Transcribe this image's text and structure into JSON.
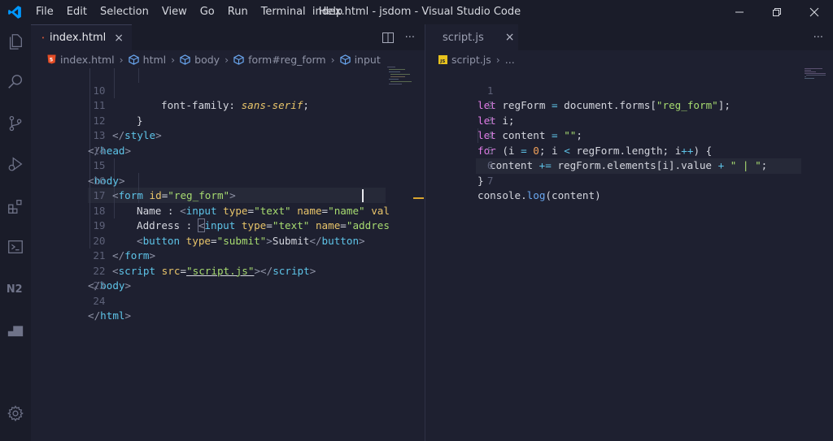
{
  "menu": [
    "File",
    "Edit",
    "Selection",
    "View",
    "Go",
    "Run",
    "Terminal",
    "Help"
  ],
  "window_title": "index.html - jsdom - Visual Studio Code",
  "colors": {
    "accent": "#0098ff",
    "html_icon": "#e44d26",
    "js_icon": "#e8c31d",
    "background": "#1e2030",
    "chrome": "#1a1c29"
  },
  "activity_icons": [
    "explorer-icon",
    "search-icon",
    "source-control-icon",
    "run-debug-icon",
    "extensions-icon",
    "terminal-icon",
    "n2-icon",
    "square-icon",
    "settings-gear-icon"
  ],
  "left": {
    "tab": {
      "label": "index.html",
      "close": "×",
      "icon": "html-file-icon"
    },
    "actions": {
      "split": "split-editor-icon",
      "more": "···"
    },
    "breadcrumb": [
      "index.html",
      "html",
      "body",
      "form#reg_form",
      "input"
    ],
    "line_numbers": [
      "10",
      "11",
      "12",
      "13",
      "14",
      "15",
      "16",
      "17",
      "18",
      "19",
      "20",
      "21",
      "22",
      "23",
      "24"
    ],
    "code": {
      "l10": {
        "prop": "font-family",
        "colon": ": ",
        "val": "sans-serif",
        "semi": ";"
      },
      "l11": "}",
      "l12": {
        "open": "</",
        "tag": "style",
        "close": ">"
      },
      "l13": {
        "open": "</",
        "tag": "head",
        "close": ">"
      },
      "l14": "",
      "l15": {
        "open": "<",
        "tag": "body",
        "close": ">"
      },
      "l16": {
        "open": "<",
        "tag": "form",
        "attr": " id",
        "eq": "=",
        "str": "\"reg_form\"",
        "close": ">"
      },
      "l17": {
        "text": "Name : ",
        "open": "<",
        "tag": "input",
        "a1": " type",
        "eq1": "=",
        "s1": "\"text\"",
        "a2": " name",
        "eq2": "=",
        "s2": "\"name\"",
        "a3": " val"
      },
      "l18": {
        "text": "Address : ",
        "open": "<",
        "tag": "input",
        "a1": " type",
        "eq1": "=",
        "s1": "\"text\"",
        "a2": " name",
        "eq2": "=",
        "s2": "\"addres"
      },
      "l19": {
        "open": "<",
        "tag": "button",
        "a1": " type",
        "eq1": "=",
        "s1": "\"submit\"",
        "close": ">",
        "text": "Submit",
        "copen": "</",
        "ctag": "button",
        "cclose": ">"
      },
      "l20": {
        "open": "</",
        "tag": "form",
        "close": ">"
      },
      "l21": {
        "open": "<",
        "tag": "script",
        "a1": " src",
        "eq1": "=",
        "s1": "\"script.js\"",
        "close": ">",
        "copen": "</",
        "ctag": "script",
        "cclose": ">"
      },
      "l22": {
        "open": "</",
        "tag": "body",
        "close": ">"
      },
      "l23": "",
      "l24": {
        "open": "</",
        "tag": "html",
        "close": ">"
      }
    }
  },
  "right": {
    "tab": {
      "label": "script.js",
      "close": "×",
      "icon": "js-file-icon"
    },
    "actions": {
      "more": "···"
    },
    "breadcrumb": [
      "script.js",
      "..."
    ],
    "line_numbers": [
      "1",
      "2",
      "3",
      "4",
      "5",
      "6",
      "7"
    ],
    "code": {
      "l1": {
        "kw": "let",
        "a": " regForm ",
        "op": "=",
        "b": " document.forms[",
        "str": "\"reg_form\"",
        "c": "];"
      },
      "l2": {
        "kw": "let",
        "a": " i;"
      },
      "l3": {
        "kw": "let",
        "a": " content ",
        "op": "=",
        "sp": " ",
        "str": "\"\"",
        "c": ";"
      },
      "l4": {
        "kw": "for",
        "a": " (i ",
        "op1": "=",
        "sp1": " ",
        "n1": "0",
        "b": "; i ",
        "op2": "<",
        "c": " regForm.length; i",
        "op3": "++",
        "d": ") {"
      },
      "l5": {
        "a": "content ",
        "op1": "+=",
        "b": " regForm.elements[i].value ",
        "op2": "+",
        "sp": " ",
        "str": "\" | \"",
        "c": ";"
      },
      "l6": "}",
      "l7": {
        "a": "console.",
        "fn": "log",
        "b": "(content)"
      }
    }
  }
}
